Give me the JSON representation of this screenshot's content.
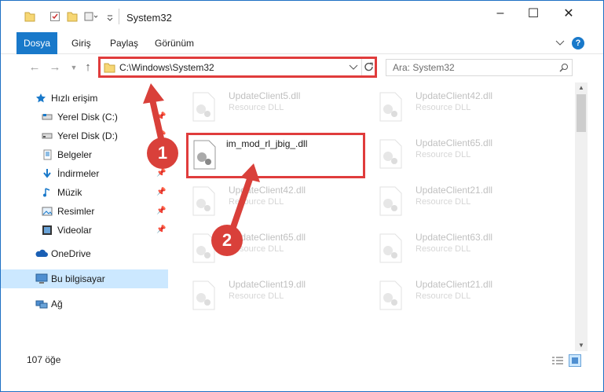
{
  "window": {
    "title": "System32"
  },
  "ribbon": {
    "tabs": [
      "Dosya",
      "Giriş",
      "Paylaş",
      "Görünüm"
    ],
    "help_label": "?"
  },
  "address": {
    "path": "C:\\Windows\\System32",
    "search_placeholder": "Ara: System32"
  },
  "nav": {
    "items": [
      {
        "label": "Hızlı erişim",
        "icon": "star-icon"
      },
      {
        "label": "Yerel Disk (C:)",
        "icon": "drive-icon"
      },
      {
        "label": "Yerel Disk (D:)",
        "icon": "drive-icon"
      },
      {
        "label": "Belgeler",
        "icon": "documents-icon"
      },
      {
        "label": "İndirmeler",
        "icon": "download-icon"
      },
      {
        "label": "Müzik",
        "icon": "music-icon"
      },
      {
        "label": "Resimler",
        "icon": "pictures-icon"
      },
      {
        "label": "Videolar",
        "icon": "video-icon"
      },
      {
        "label": "OneDrive",
        "icon": "cloud-icon"
      },
      {
        "label": "Bu bilgisayar",
        "icon": "computer-icon"
      },
      {
        "label": "Ağ",
        "icon": "network-icon"
      }
    ]
  },
  "files": [
    {
      "name": "UpdateClient5.dll",
      "type": "Resource DLL"
    },
    {
      "name": "UpdateClient42.dll",
      "type": "Resource DLL"
    },
    {
      "name": "im_mod_rl_jbig_.dll",
      "type": ""
    },
    {
      "name": "UpdateClient65.dll",
      "type": "Resource DLL"
    },
    {
      "name": "UpdateClient42.dll",
      "type": "Resource DLL"
    },
    {
      "name": "UpdateClient21.dll",
      "type": "Resource DLL"
    },
    {
      "name": "UpdateClient65.dll",
      "type": "Resource DLL"
    },
    {
      "name": "UpdateClient63.dll",
      "type": "Resource DLL"
    },
    {
      "name": "UpdateClient19.dll",
      "type": "Resource DLL"
    },
    {
      "name": "UpdateClient21.dll",
      "type": "Resource DLL"
    }
  ],
  "status": {
    "count": "107 öğe"
  },
  "annotations": {
    "step1": "1",
    "step2": "2"
  },
  "colors": {
    "accent": "#1979ca",
    "highlight": "#e03c3c",
    "selected": "#cce8ff"
  }
}
